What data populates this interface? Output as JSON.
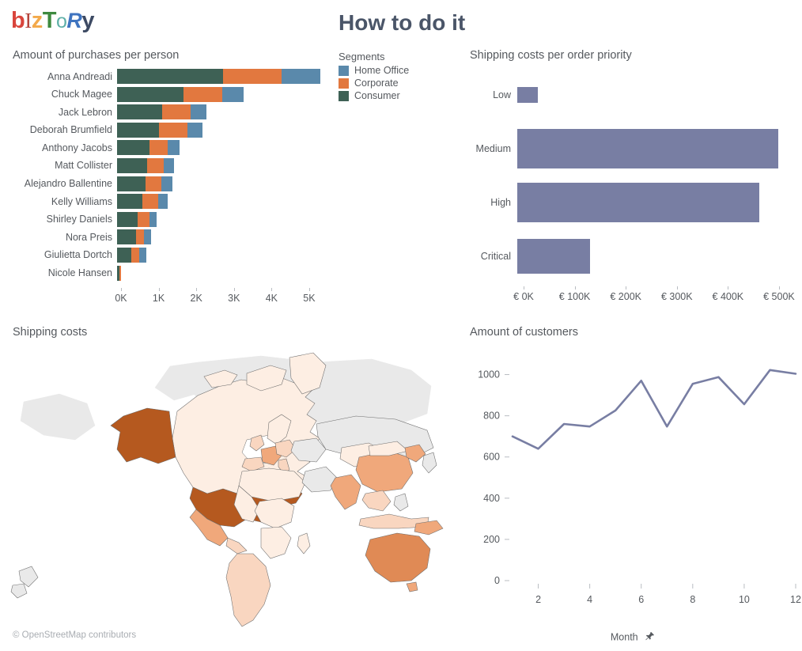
{
  "brand": {
    "logo_letters": [
      {
        "char": "b",
        "color": "#d9453c"
      },
      {
        "char": "I",
        "color": "#b4453c"
      },
      {
        "char": "z",
        "color": "#f3a94b"
      },
      {
        "char": "T",
        "color": "#3e8a3f"
      },
      {
        "char": "o",
        "color": "#5fb0a8"
      },
      {
        "char": "R",
        "color": "#3f74c0"
      },
      {
        "char": "y",
        "color": "#3d4a63"
      }
    ],
    "logo_text": "bIzToRy"
  },
  "dashboard": {
    "title": "How to do it",
    "title_color": "#4a5568"
  },
  "legend": {
    "title": "Segments",
    "items": [
      {
        "label": "Home Office",
        "color": "#5a89ab"
      },
      {
        "label": "Corporate",
        "color": "#e2783f"
      },
      {
        "label": "Consumer",
        "color": "#3e6155"
      }
    ]
  },
  "chart_data": [
    {
      "id": "purchases",
      "type": "bar",
      "orientation": "horizontal",
      "stacked": true,
      "title": "Amount of purchases per person",
      "xlabel": "",
      "ylabel": "",
      "xlim": [
        0,
        5400
      ],
      "xticks": [
        0,
        1000,
        2000,
        3000,
        4000,
        5000
      ],
      "xticklabels": [
        "0K",
        "1K",
        "2K",
        "3K",
        "4K",
        "5K"
      ],
      "grid": false,
      "legend_position": "top-right-outside",
      "categories": [
        "Anna Andreadi",
        "Chuck Magee",
        "Jack Lebron",
        "Deborah Brumfield",
        "Anthony Jacobs",
        "Matt Collister",
        "Alejandro Ballentine",
        "Kelly Williams",
        "Shirley Daniels",
        "Nora Preis",
        "Giulietta Dortch",
        "Nicole Hansen"
      ],
      "series": [
        {
          "name": "Consumer",
          "color": "#3e6155",
          "values": [
            2815,
            1755,
            1205,
            1120,
            855,
            790,
            760,
            675,
            540,
            500,
            380,
            70
          ]
        },
        {
          "name": "Corporate",
          "color": "#e2783f",
          "values": [
            1560,
            1040,
            745,
            760,
            500,
            460,
            415,
            410,
            330,
            215,
            215,
            45
          ]
        },
        {
          "name": "Home Office",
          "color": "#5a89ab",
          "values": [
            1025,
            560,
            415,
            395,
            300,
            270,
            300,
            255,
            175,
            180,
            185,
            0
          ]
        }
      ],
      "totals": [
        5400,
        3355,
        2365,
        2275,
        1655,
        1520,
        1475,
        1340,
        1045,
        895,
        780,
        115
      ]
    },
    {
      "id": "priority",
      "type": "bar",
      "orientation": "horizontal",
      "stacked": false,
      "title": "Shipping costs per order priority",
      "xlabel": "",
      "ylabel": "",
      "xlim": [
        0,
        545000
      ],
      "xticks": [
        0,
        100000,
        200000,
        300000,
        400000,
        500000
      ],
      "xticklabels": [
        "€ 0K",
        "€ 100K",
        "€ 200K",
        "€ 300K",
        "€ 400K",
        "€ 500K"
      ],
      "grid": false,
      "bar_color": "#787ea3",
      "categories": [
        "Low",
        "Medium",
        "High",
        "Critical"
      ],
      "values": [
        41000,
        511000,
        474000,
        142000
      ],
      "bar_thickness": [
        0.28,
        0.74,
        0.74,
        0.65
      ]
    },
    {
      "id": "shipping-map",
      "type": "heatmap",
      "map_style": "choropleth",
      "title": "Shipping costs",
      "credit": "© OpenStreetMap contributors",
      "legend_position": "none",
      "color_scale": [
        "#fdeee3",
        "#f9d6c0",
        "#f0a87b",
        "#e08a55",
        "#b5591f"
      ],
      "no_data_color": "#e8e8e8",
      "regions": [
        {
          "name": "United States",
          "level": 5
        },
        {
          "name": "Alaska",
          "level": 5
        },
        {
          "name": "Canada",
          "level": 1
        },
        {
          "name": "Mexico",
          "level": 3
        },
        {
          "name": "Brazil",
          "level": 2
        },
        {
          "name": "Australia",
          "level": 4
        },
        {
          "name": "China",
          "level": 4
        },
        {
          "name": "India",
          "level": 4
        },
        {
          "name": "France",
          "level": 4
        },
        {
          "name": "United Kingdom",
          "level": 3
        },
        {
          "name": "Germany",
          "level": 3
        },
        {
          "name": "Africa",
          "level": 1
        },
        {
          "name": "Russia",
          "level": 0
        }
      ]
    },
    {
      "id": "customers",
      "type": "line",
      "title": "Amount of customers",
      "xlabel": "Month",
      "ylabel": "",
      "xlabel_icon": "pin-icon",
      "line_color": "#787ea3",
      "grid": false,
      "xlim": [
        1,
        12
      ],
      "ylim": [
        0,
        1075
      ],
      "xticks": [
        2,
        4,
        6,
        8,
        10,
        12
      ],
      "xticklabels": [
        "2",
        "4",
        "6",
        "8",
        "10",
        "12"
      ],
      "yticks": [
        0,
        200,
        400,
        600,
        800,
        1000
      ],
      "yticklabels": [
        "0",
        "200",
        "400",
        "600",
        "800",
        "1000"
      ],
      "x": [
        1,
        2,
        3,
        4,
        5,
        6,
        7,
        8,
        9,
        10,
        11,
        12
      ],
      "values": [
        700,
        640,
        760,
        748,
        826,
        970,
        748,
        955,
        988,
        856,
        1022,
        1004
      ]
    }
  ]
}
